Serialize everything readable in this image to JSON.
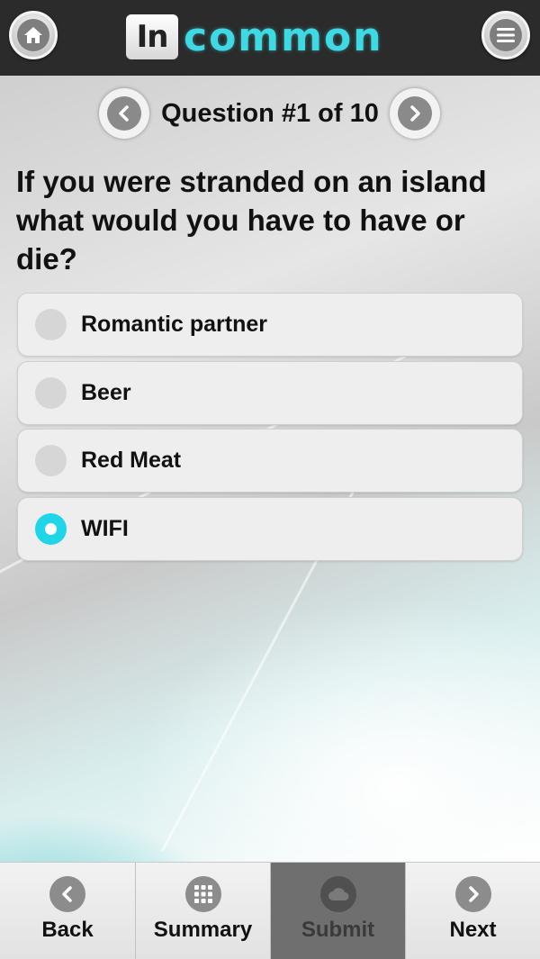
{
  "header": {
    "home_icon": "home-icon",
    "menu_icon": "menu-icon",
    "logo": {
      "box_text": "In",
      "word": "common"
    }
  },
  "question_nav": {
    "counter": "Question #1 of 10",
    "prev_icon": "chevron-left-icon",
    "next_icon": "chevron-right-icon"
  },
  "question": {
    "text": "If you were stranded on an island what would you have to have or die?"
  },
  "options": [
    {
      "label": "Romantic partner",
      "selected": false
    },
    {
      "label": "Beer",
      "selected": false
    },
    {
      "label": "Red Meat",
      "selected": false
    },
    {
      "label": "WIFI",
      "selected": true
    }
  ],
  "footer": {
    "tabs": [
      {
        "label": "Back",
        "icon": "chevron-left-icon",
        "enabled": true
      },
      {
        "label": "Summary",
        "icon": "grid-icon",
        "enabled": true
      },
      {
        "label": "Submit",
        "icon": "cloud-icon",
        "enabled": false
      },
      {
        "label": "Next",
        "icon": "chevron-right-icon",
        "enabled": true
      }
    ]
  },
  "colors": {
    "accent": "#1fd6e8",
    "header_bg": "#2b2b2b",
    "logo_cyan": "#3fd9e3"
  }
}
